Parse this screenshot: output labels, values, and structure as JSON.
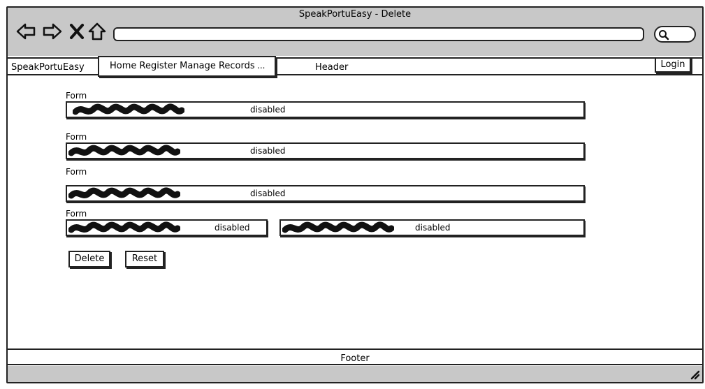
{
  "window": {
    "title": "SpeakPortuEasy - Delete"
  },
  "browser": {
    "back_icon": "back-arrow-icon",
    "forward_icon": "forward-arrow-icon",
    "stop_icon": "close-x-icon",
    "home_icon": "home-icon",
    "address_value": "",
    "search_icon": "search-icon"
  },
  "header": {
    "brand": "SpeakPortuEasy",
    "menu": "Home Register Manage Records",
    "menu_more": "...",
    "label": "Header",
    "login": "Login"
  },
  "forms": [
    {
      "label": "Form",
      "fields": [
        {
          "value": "disabled"
        }
      ]
    },
    {
      "label": "Form",
      "fields": [
        {
          "value": "disabled"
        }
      ]
    },
    {
      "label": "Form",
      "fields": [
        {
          "value": "disabled"
        }
      ]
    },
    {
      "label": "Form",
      "fields": [
        {
          "value": "disabled"
        },
        {
          "value": "disabled"
        }
      ]
    }
  ],
  "buttons": {
    "delete": "Delete",
    "reset": "Reset"
  },
  "footer": {
    "label": "Footer"
  }
}
